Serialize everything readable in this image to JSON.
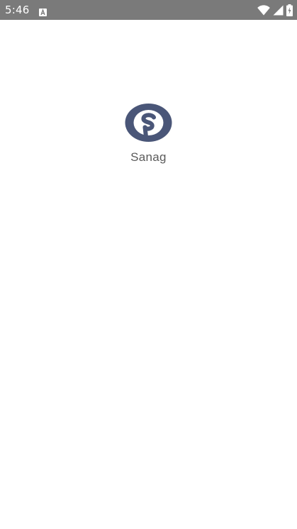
{
  "status_bar": {
    "time": "5:46",
    "icons": [
      "text-recognition-icon",
      "wifi-icon",
      "cellular-signal-icon",
      "battery-icon"
    ],
    "color": "#7a7a7a"
  },
  "splash": {
    "app_name": "Sanag",
    "logo_icon": "sanag-logo-icon",
    "logo_color": "#4a5678"
  }
}
